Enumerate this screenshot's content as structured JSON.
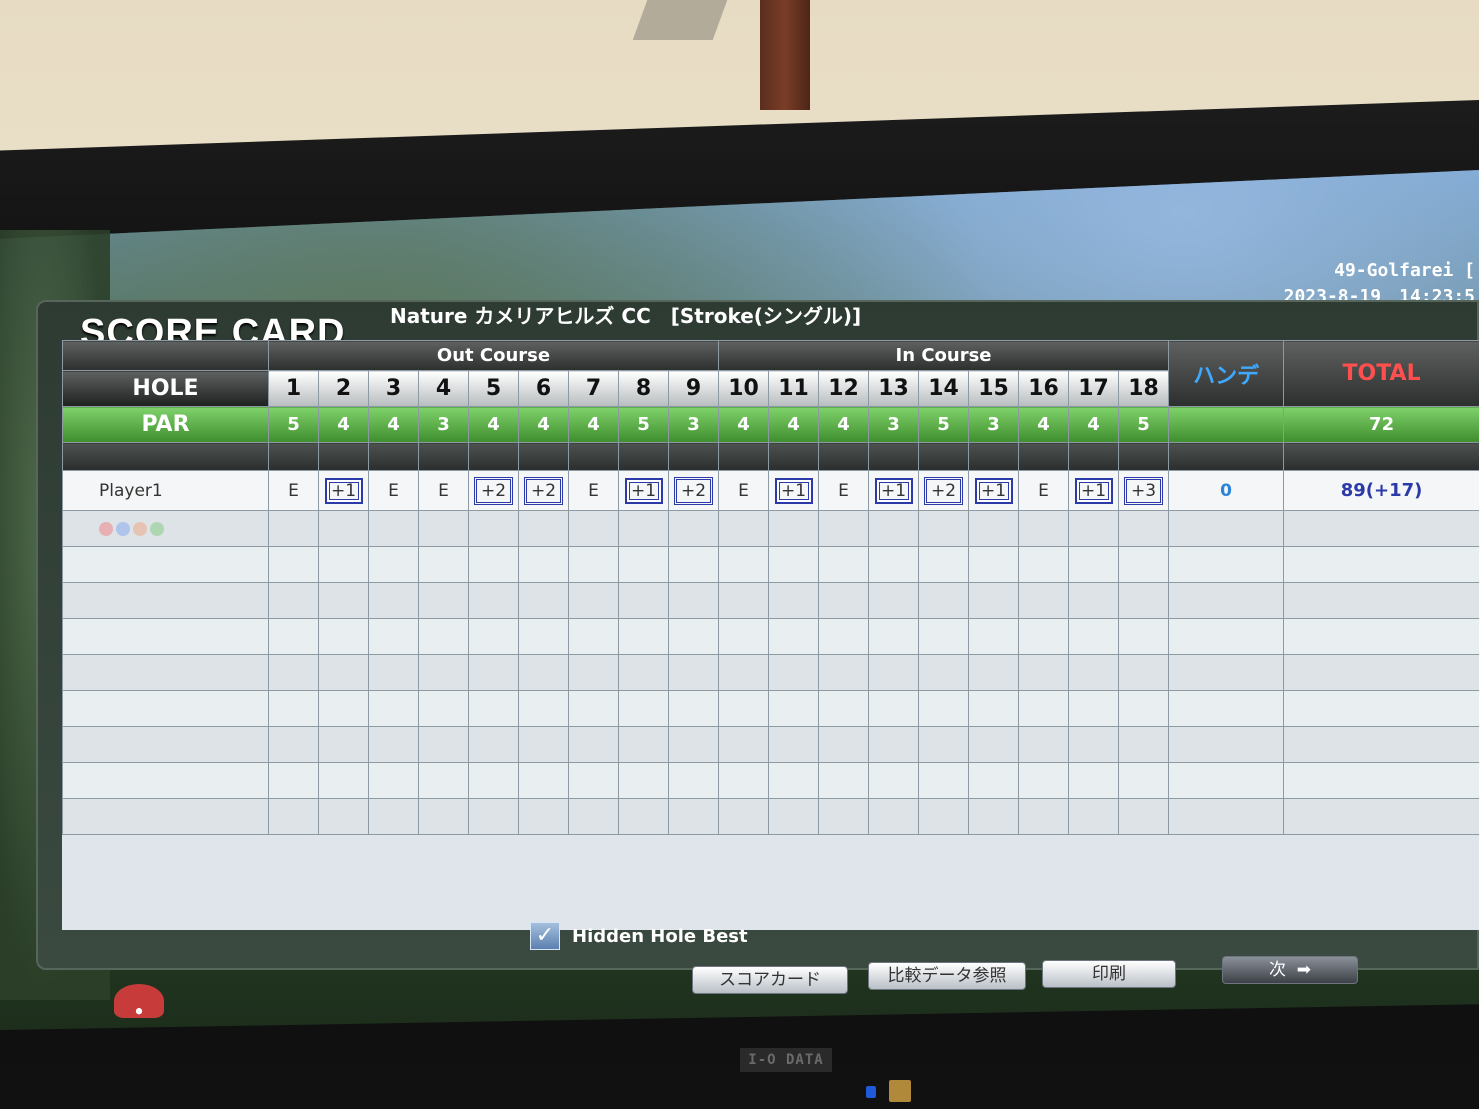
{
  "header": {
    "title": "SCORE CARD",
    "course": "Nature カメリアヒルズ CC　[Stroke(シングル)]",
    "station": "49-Golfarei [",
    "datetime": "2023-8-19　14:23:5"
  },
  "table": {
    "out_label": "Out Course",
    "in_label": "In Course",
    "hole_label": "HOLE",
    "par_label": "PAR",
    "handicap_label": "ハンデ",
    "total_label": "TOTAL",
    "holes": [
      "1",
      "2",
      "3",
      "4",
      "5",
      "6",
      "7",
      "8",
      "9",
      "10",
      "11",
      "12",
      "13",
      "14",
      "15",
      "16",
      "17",
      "18"
    ],
    "pars": [
      "5",
      "4",
      "4",
      "3",
      "4",
      "4",
      "4",
      "5",
      "3",
      "4",
      "4",
      "4",
      "3",
      "5",
      "3",
      "4",
      "4",
      "5"
    ],
    "par_total": "72",
    "players": [
      {
        "name": "Player1",
        "scores": [
          "E",
          "+1",
          "E",
          "E",
          "+2",
          "+2",
          "E",
          "+1",
          "+2",
          "E",
          "+1",
          "E",
          "+1",
          "+2",
          "+1",
          "E",
          "+1",
          "+3"
        ],
        "marks": [
          "",
          "box",
          "",
          "",
          "dbl",
          "dbl",
          "",
          "box",
          "dbl",
          "",
          "box",
          "",
          "box",
          "dbl",
          "box",
          "",
          "box",
          "dbl"
        ],
        "handicap": "0",
        "total": "89(+17)"
      }
    ]
  },
  "controls": {
    "hidden_hole_best_label": "Hidden Hole Best",
    "hidden_hole_best_checked": true,
    "buttons": {
      "scorecard": "スコアカード",
      "compare": "比較データ参照",
      "print": "印刷",
      "next": "次"
    }
  },
  "monitor": {
    "brand": "I-O DATA"
  },
  "colors": {
    "par_green": "#3f8d2d",
    "handicap_blue": "#3fa9ff",
    "total_red": "#ff4f4f",
    "score_blue": "#2b3aa8"
  }
}
